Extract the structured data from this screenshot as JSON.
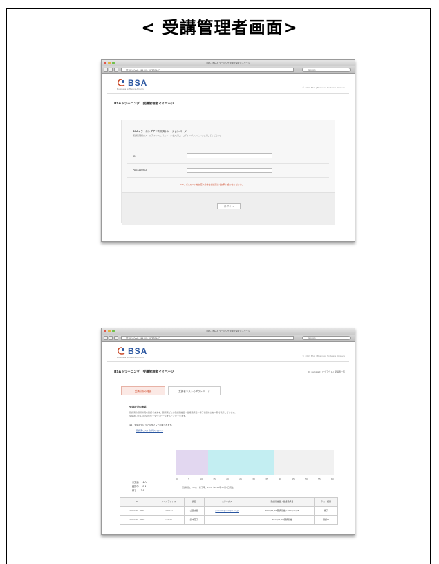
{
  "title": "< 受講管理者画面>",
  "shot1": {
    "window_title": "BSA - BSAｅラーニング受講管理者マイページ",
    "url": "http://www.bsa.or.jp/mlms/?",
    "search_placeholder": "Google",
    "logo_text": "BSA",
    "logo_sub": "Business Software Alliance",
    "header_right": "© 2013 BSA | Business Software Alliance",
    "page_heading": "BSAｅラーニング　受講管理者マイページ",
    "panel_heading": "BSAｅラーニングアドミニストレーションページ",
    "panel_desc": "受講管理者のメールアドレスとパスワードを入力し、ログインボタンをクリックしてください。",
    "id_label": "ID",
    "password_label": "PASSWORD",
    "note": "※ID、パスワードをお忘れの方は担当者までお問い合わせください。",
    "login_button": "ログイン"
  },
  "shot2": {
    "window_title": "BSA - BSAｅラーニング受講管理者マイページ",
    "url": "http://www.bsa.or.jp/mlms/?",
    "search_placeholder": "Google",
    "logo_text": "BSA",
    "logo_sub": "Business Software Alliance",
    "header_right": "© 2013 BSA | Business Software Alliance",
    "page_heading": "BSAｅラーニング　受講管理者マイページ",
    "user_info": "ID: sample01 ログアウト | 受講者一覧",
    "user_link": "ログアウト",
    "tab_status": "受講状況の確認",
    "tab_list": "受講者リストのダウンロード",
    "status_heading": "受講状況の確認",
    "status_desc_1": "受講者の受講状況を確認できます。受講者ごとの受講開始日・最終受講日・修了状況などを一覧で表示しています。",
    "status_desc_2": "受講者リストはCSV形式でダウンロードすることができます。",
    "status_note": "※1　受講状況はリアルタイムで反映されます。",
    "status_link": "受講者リストのダウンロード",
    "legend": [
      "未受講 ：12人",
      "受講中 ：25人",
      "修了 ：13人"
    ],
    "ticks": [
      "0",
      "5",
      "10",
      "15",
      "20",
      "25",
      "30",
      "35",
      "40",
      "45",
      "50",
      "55",
      "60"
    ],
    "bar_caption": "受講者数：50人　修了率：26%（2013年11月1日現在）",
    "table_headers": [
      "ID",
      "メールアドレス",
      "氏名",
      "ステータス",
      "受講開始日 / 最終受講日",
      "テスト結果"
    ],
    "table_rows": [
      [
        "sample01-0001",
        "yamada",
        "山田太郎",
        "yamada@sample.co.jp",
        "2013/11/01受講開始 / 2013/11/05",
        "修了"
      ],
      [
        "sample01-0002",
        "suzuki",
        "鈴木花子",
        "",
        "2013/11/02受講開始",
        "受講中"
      ]
    ]
  },
  "colors": {
    "not_started": "#e2d7f0",
    "in_progress": "#c3eef2",
    "completed": "#f1f1f1",
    "accent": "#d04a2a"
  },
  "chart_data": {
    "type": "bar",
    "orientation": "horizontal",
    "stacked": true,
    "categories": [
      "未受講",
      "受講中",
      "修了"
    ],
    "values": [
      12,
      25,
      13
    ],
    "xlim": [
      0,
      60
    ]
  }
}
